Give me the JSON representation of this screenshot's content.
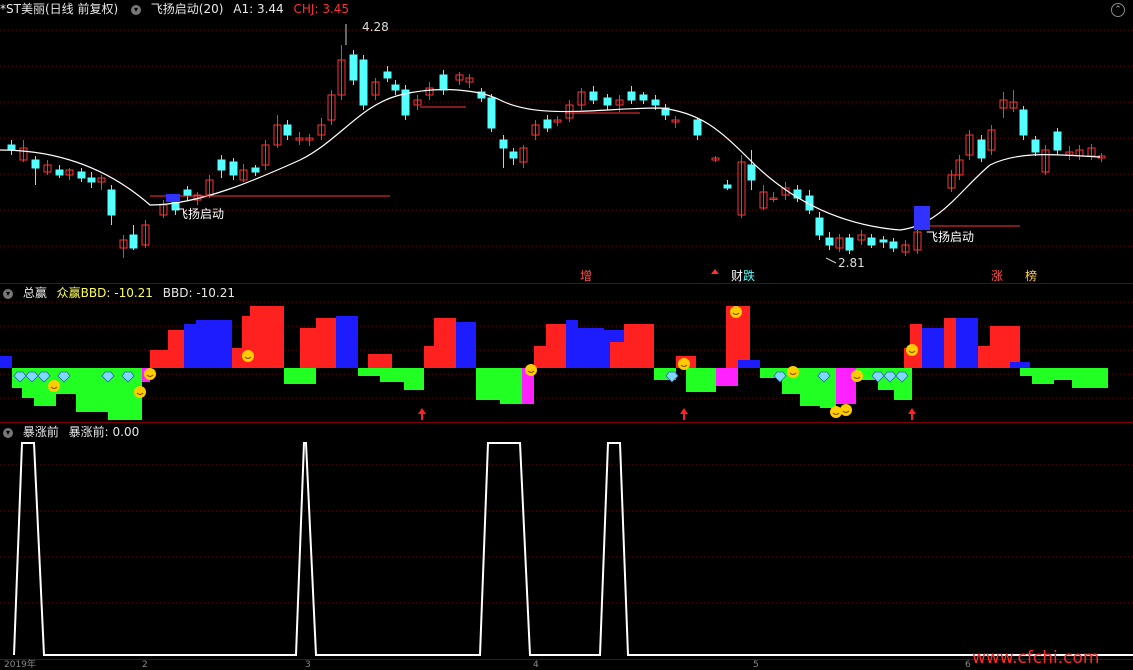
{
  "main": {
    "stock_label": "*ST美丽",
    "period_label": "(日线 前复权)",
    "indicator_label": "飞扬启动(20)",
    "a1_label": "A1: 3.44",
    "chj_label": "CHJ: 3.45",
    "high_mark": "4.28",
    "low_mark": "2.81",
    "signal_label": "飞扬启动",
    "event_tags": [
      "增",
      "财",
      "跌",
      "涨",
      "榜"
    ],
    "colors": {
      "up": "#ff3232",
      "down": "#54ffff",
      "ma": "#ffffff",
      "signal": "#3232ff"
    }
  },
  "bbd": {
    "title": "总赢",
    "value_name": "众赢BBD: -10.21",
    "bbd_label": "BBD: -10.21",
    "colors": {
      "red": "#ff2020",
      "blue": "#1c1cff",
      "green": "#22ff22",
      "magenta": "#ff22ff"
    }
  },
  "pre": {
    "title": "暴涨前",
    "value_label": "暴涨前: 0.00"
  },
  "axis": {
    "year_label": "2019年",
    "ticks": [
      "2",
      "3",
      "4",
      "5",
      "6"
    ]
  },
  "watermark": "www.cfchi.com"
}
